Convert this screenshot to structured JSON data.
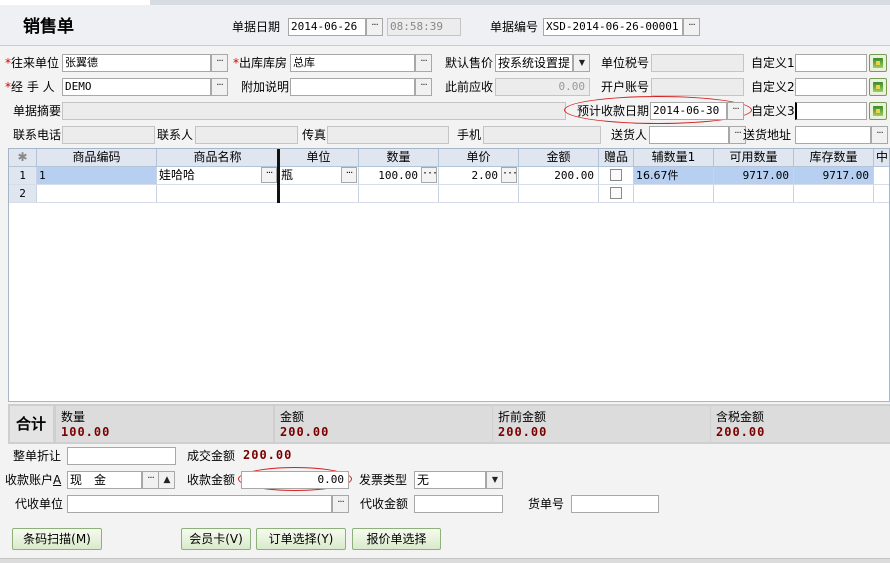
{
  "header": {
    "title": "销售单",
    "date_label": "单据日期",
    "date_value": "2014-06-26",
    "time_value": "08:58:39",
    "number_label": "单据编号",
    "number_value": "XSD-2014-06-26-00001"
  },
  "form": {
    "customer_label": "往来单位",
    "customer_value": "张翼德",
    "warehouse_label": "出库库房",
    "warehouse_value": "总库",
    "price_label": "默认售价",
    "price_value": "按系统设置提",
    "tax_no_label": "单位税号",
    "custom1_label": "自定义1",
    "handler_label": "经 手 人",
    "handler_value": "DEMO",
    "remark_label": "附加说明",
    "prev_receivable_label": "此前应收",
    "prev_receivable_value": "0.00",
    "bank_account_label": "开户账号",
    "custom2_label": "自定义2",
    "summary_label": "单据摘要",
    "expected_date_label": "预计收款日期",
    "expected_date_value": "2014-06-30",
    "custom3_label": "自定义3",
    "phone_label": "联系电话",
    "contact_label": "联系人",
    "fax_label": "传真",
    "mobile_label": "手机",
    "delivery_person_label": "送货人",
    "delivery_address_label": "送货地址"
  },
  "grid": {
    "columns": [
      "商品编码",
      "商品名称",
      "单位",
      "数量",
      "单价",
      "金额",
      "赠品",
      "辅数量1",
      "可用数量",
      "库存数量",
      "中"
    ],
    "rows": [
      {
        "row_no": "1",
        "code": "1",
        "name": "娃哈哈",
        "unit": "瓶",
        "qty": "100.00",
        "price": "2.00",
        "amount": "200.00",
        "aux_qty": "16.67件",
        "available": "9717.00",
        "stock": "9717.00"
      },
      {
        "row_no": "2",
        "code": "",
        "name": "",
        "unit": "",
        "qty": "",
        "price": "",
        "amount": "",
        "aux_qty": "",
        "available": "",
        "stock": ""
      }
    ]
  },
  "totals": {
    "label": "合计",
    "qty_label": "数量",
    "qty_value": "100.00",
    "amount_label": "金额",
    "amount_value": "200.00",
    "pre_discount_label": "折前金额",
    "pre_discount_value": "200.00",
    "tax_amount_label": "含税金额",
    "tax_amount_value": "200.00"
  },
  "payment": {
    "discount_label": "整单折让",
    "deal_amount_label": "成交金额",
    "deal_amount_value": "200.00",
    "account_label": "收款账户",
    "account_hotkey": "A",
    "account_value": "现　金",
    "received_label": "收款金额",
    "received_value": "0.00",
    "invoice_label": "发票类型",
    "invoice_value": "无",
    "agent_unit_label": "代收单位",
    "agent_amount_label": "代收金额",
    "waybill_label": "货单号"
  },
  "buttons": {
    "barcode": "条码扫描(M)",
    "member_card": "会员卡(V)",
    "order_select": "订单选择(Y)",
    "quote_select": "报价单选择"
  }
}
